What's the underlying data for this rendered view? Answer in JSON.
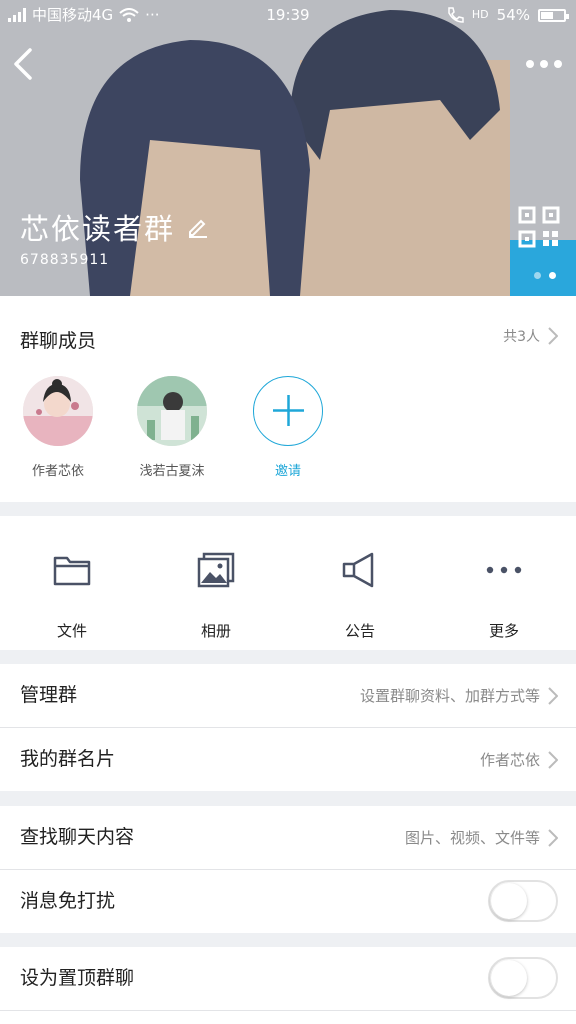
{
  "status_bar": {
    "carrier": "中国移动4G",
    "extra": "···",
    "time": "19:39",
    "hd": "HD",
    "battery_text": "54%",
    "battery_level": 0.54
  },
  "header": {
    "group_name": "芯依读者群",
    "group_id": "678835911"
  },
  "members_section": {
    "title": "群聊成员",
    "count_text": "共3人",
    "members": [
      {
        "name": "作者芯依"
      },
      {
        "name": "浅若古夏沫"
      }
    ],
    "invite_label": "邀请"
  },
  "features": [
    {
      "label": "文件",
      "icon": "folder-icon"
    },
    {
      "label": "相册",
      "icon": "album-icon"
    },
    {
      "label": "公告",
      "icon": "megaphone-icon"
    },
    {
      "label": "更多",
      "icon": "more-dots-icon"
    }
  ],
  "settings": {
    "manage_group": {
      "label": "管理群",
      "value": "设置群聊资料、加群方式等"
    },
    "my_card": {
      "label": "我的群名片",
      "value": "作者芯依"
    },
    "search_chat": {
      "label": "查找聊天内容",
      "value": "图片、视频、文件等"
    },
    "do_not_disturb": {
      "label": "消息免打扰",
      "enabled": false
    },
    "pin_chat": {
      "label": "设为置顶群聊",
      "enabled": false
    }
  },
  "colors": {
    "accent": "#1fa7d8",
    "hero_bg": "#b9bbc0"
  }
}
